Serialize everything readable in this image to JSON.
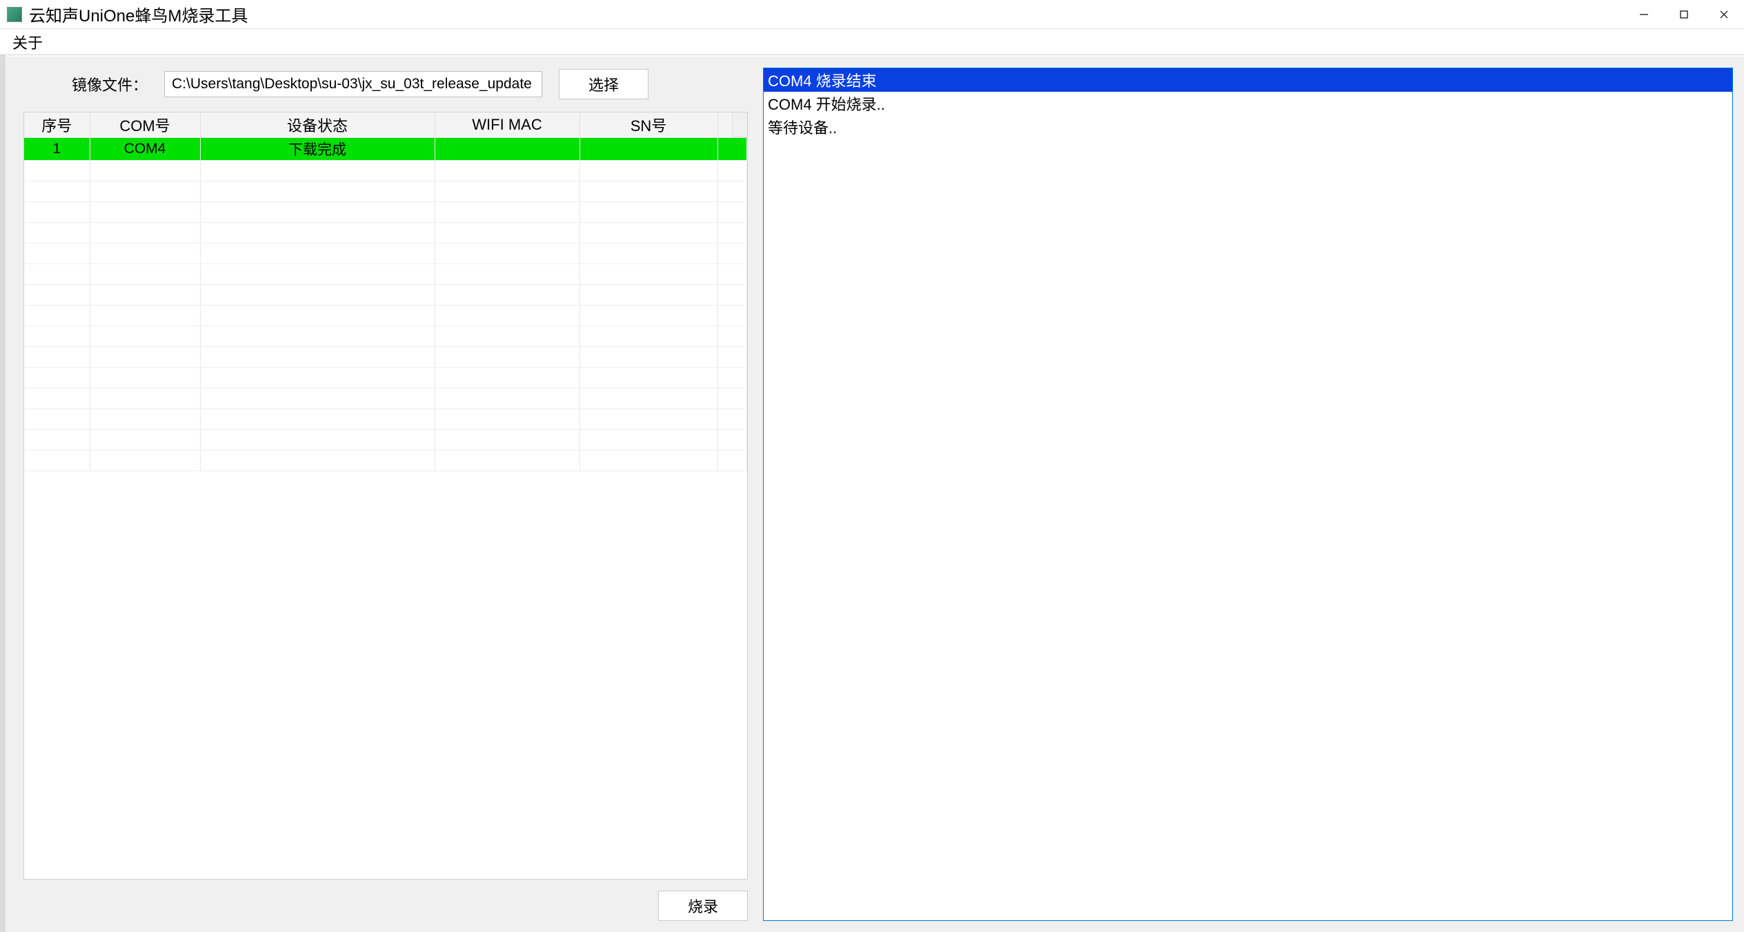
{
  "window": {
    "title": "云知声UniOne蜂鸟M烧录工具"
  },
  "menu": {
    "about": "关于"
  },
  "image_file": {
    "label": "镜像文件：",
    "path": "C:\\Users\\tang\\Desktop\\su-03\\jx_su_03t_release_update",
    "browse_button": "选择"
  },
  "table": {
    "headers": {
      "index": "序号",
      "com": "COM号",
      "status": "设备状态",
      "wifi_mac": "WIFI MAC",
      "sn": "SN号"
    },
    "rows": [
      {
        "index": "1",
        "com": "COM4",
        "status": "下载完成",
        "wifi_mac": "",
        "sn": "",
        "status_class": "done"
      }
    ],
    "empty_row_count": 15
  },
  "flash_button": "烧录",
  "log": {
    "lines": [
      {
        "text": "COM4 烧录结束",
        "selected": true
      },
      {
        "text": "COM4 开始烧录..",
        "selected": false
      },
      {
        "text": "等待设备..",
        "selected": false
      }
    ]
  }
}
